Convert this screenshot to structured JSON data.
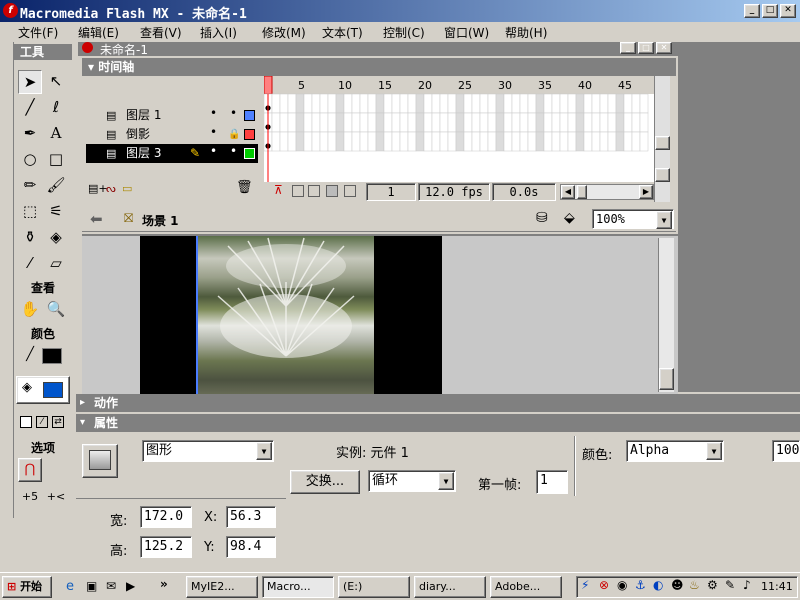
{
  "window": {
    "title": "Macromedia Flash MX - 未命名-1"
  },
  "menu": [
    "文件(F)",
    "编辑(E)",
    "查看(V)",
    "插入(I)",
    "修改(M)",
    "文本(T)",
    "控制(C)",
    "窗口(W)",
    "帮助(H)"
  ],
  "tools": {
    "header": "工具",
    "view_label": "查看",
    "color_label": "颜色",
    "options_label": "选项"
  },
  "document": {
    "title": "未命名-1"
  },
  "timeline": {
    "title": "时间轴",
    "frame_numbers": [
      "1",
      "5",
      "10",
      "15",
      "20",
      "25",
      "30",
      "35",
      "40",
      "45"
    ],
    "layers": [
      {
        "name": "图层 1",
        "color": "#4f81ff"
      },
      {
        "name": "倒影",
        "color": "#ff4040"
      },
      {
        "name": "图层 3",
        "color": "#00cc00"
      }
    ],
    "current_frame": "1",
    "fps": "12.0 fps",
    "time": "0.0s"
  },
  "scene": {
    "name": "场景 1",
    "zoom": "100%"
  },
  "panels": {
    "actions": "动作",
    "properties": "属性"
  },
  "properties": {
    "type": "图形",
    "instance_label": "实例: 元件 1",
    "swap_button": "交换...",
    "loop": "循环",
    "first_frame_label": "第一帧:",
    "first_frame": "1",
    "color_label": "颜色:",
    "color_value": "Alpha",
    "alpha_value": "100",
    "width_label": "宽:",
    "width": "172.0",
    "height_label": "高:",
    "height": "125.2",
    "x_label": "X:",
    "x": "56.3",
    "y_label": "Y:",
    "y": "98.4"
  },
  "taskbar": {
    "start": "开始",
    "tasks": [
      "MyIE2...",
      "Macro...",
      "(E:)",
      "diary...",
      "Adobe..."
    ],
    "clock": "11:41"
  }
}
